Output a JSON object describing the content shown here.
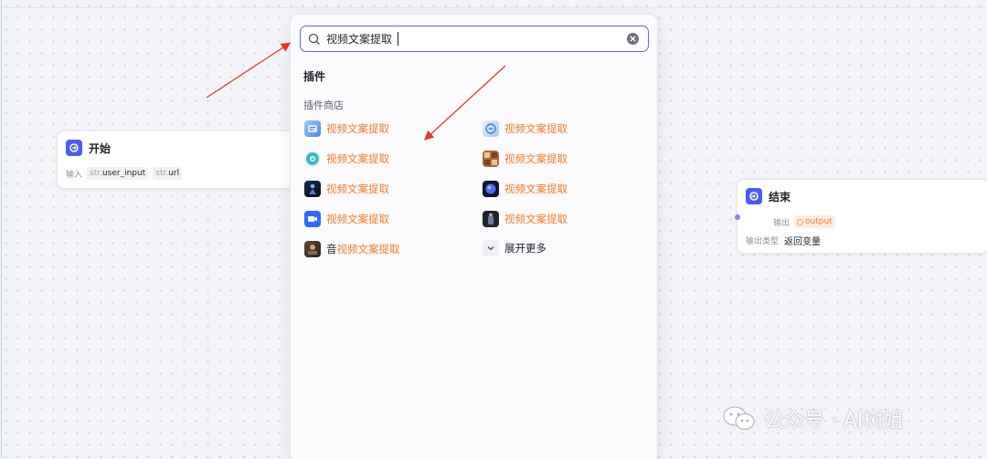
{
  "start_node": {
    "title": "开始",
    "input_label": "输入",
    "params": [
      {
        "type": "str.",
        "name": "user_input"
      },
      {
        "type": "str.",
        "name": "url"
      }
    ]
  },
  "end_node": {
    "title": "结束",
    "output_label": "输出",
    "output_name": "output",
    "output_type_label": "输出类型",
    "output_type_value": "返回变量"
  },
  "search": {
    "value": "视频文案提取",
    "placeholder": ""
  },
  "panel": {
    "section_title": "插件",
    "section_subtitle": "插件商店",
    "plugins_left": [
      {
        "prefix": "",
        "label": "视频文案提取",
        "icon": "blue-doc-icon"
      },
      {
        "prefix": "",
        "label": "视频文案提取",
        "icon": "teal-circle-icon"
      },
      {
        "prefix": "",
        "label": "视频文案提取",
        "icon": "dark-figure-icon"
      },
      {
        "prefix": "",
        "label": "视频文案提取",
        "icon": "blue-camera-icon"
      },
      {
        "prefix": "音",
        "label": "视频文案提取",
        "icon": "photo-icon"
      }
    ],
    "plugins_right": [
      {
        "label": "视频文案提取",
        "icon": "light-blue-icon"
      },
      {
        "label": "视频文案提取",
        "icon": "brown-grid-icon"
      },
      {
        "label": "视频文案提取",
        "icon": "planet-icon"
      },
      {
        "label": "视频文案提取",
        "icon": "dark-bottle-icon"
      }
    ],
    "more_label": "展开更多"
  },
  "watermark": {
    "text": "公众号 · AI树姐"
  },
  "colors": {
    "accent": "#5d66ee",
    "highlight": "#f07c2a",
    "node_icon": "#4c5bf0",
    "arrow": "#e8352b"
  }
}
